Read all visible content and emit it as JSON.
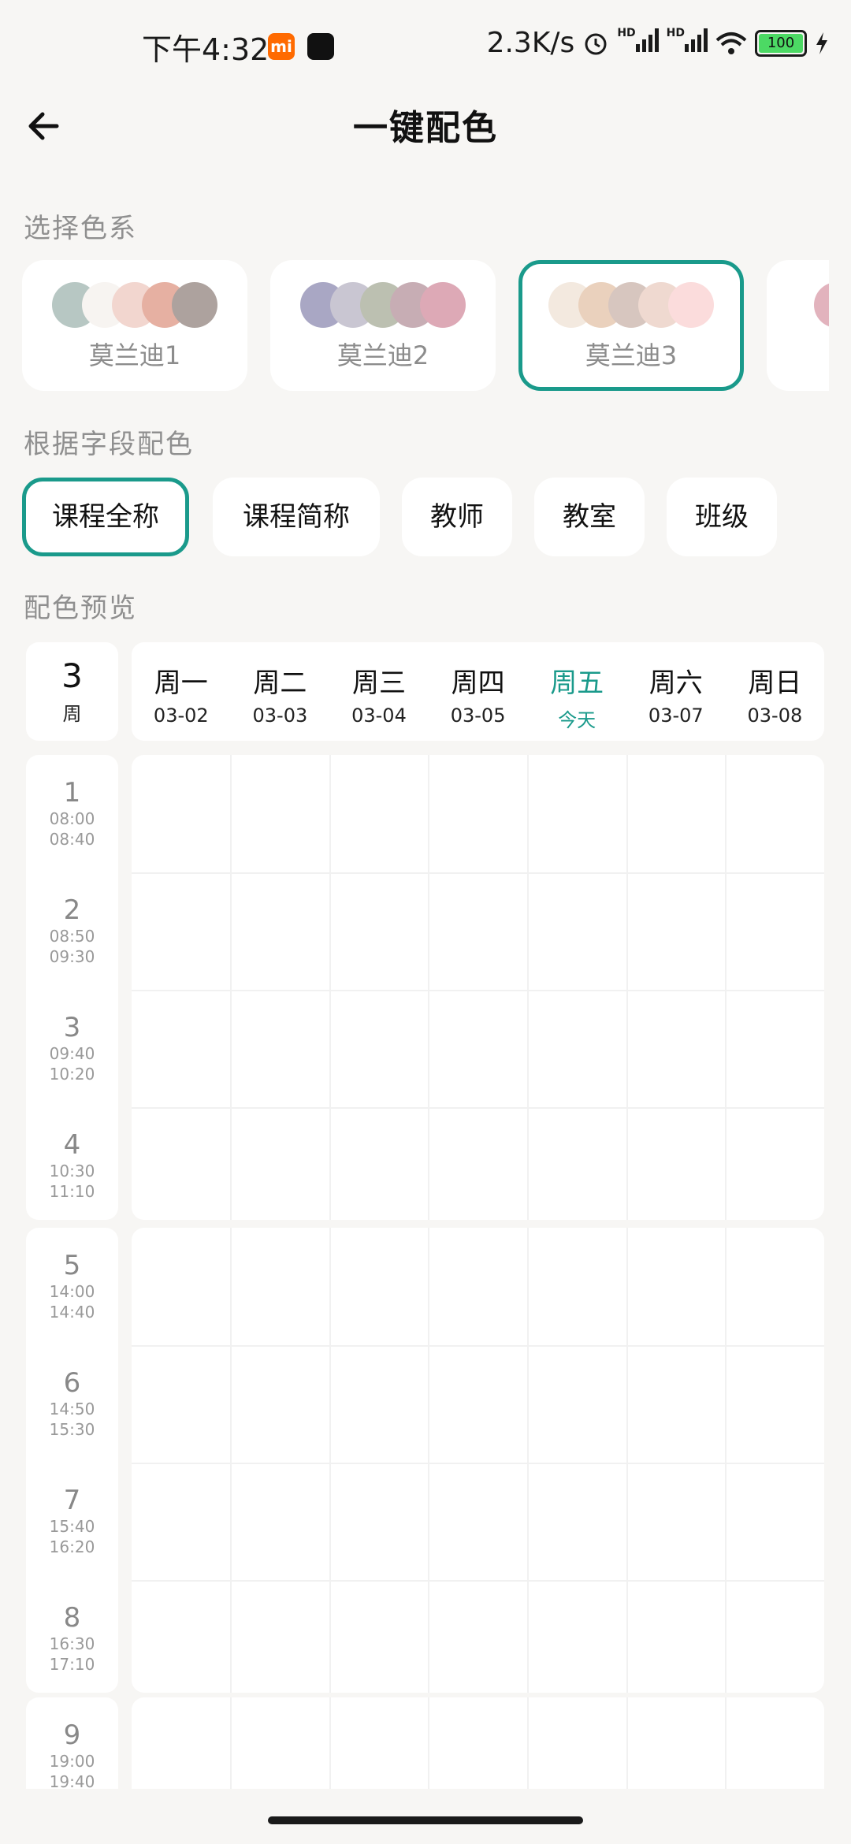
{
  "status_bar": {
    "time": "下午4:32",
    "network_speed": "2.3K/s",
    "battery": "100",
    "hd_label": "HD"
  },
  "header": {
    "title": "一键配色"
  },
  "sections": {
    "color_scheme": "选择色系",
    "by_field": "根据字段配色",
    "preview": "配色预览"
  },
  "schemes": [
    {
      "label": "莫兰迪1",
      "colors": [
        "#b7c7c3",
        "#f7f4f1",
        "#f2d6cf",
        "#e6b0a2",
        "#ada29e"
      ]
    },
    {
      "label": "莫兰迪2",
      "colors": [
        "#a9a7c4",
        "#c9c6d2",
        "#bcc0b1",
        "#c7adb4",
        "#dda9b6"
      ]
    },
    {
      "label": "莫兰迪3",
      "colors": [
        "#f3e9df",
        "#ead1bd",
        "#d7c6bf",
        "#efd9d0",
        "#fbdcdc"
      ],
      "selected": true
    }
  ],
  "fields": [
    {
      "label": "课程全称",
      "selected": true
    },
    {
      "label": "课程简称"
    },
    {
      "label": "教师"
    },
    {
      "label": "教室"
    },
    {
      "label": "班级"
    }
  ],
  "week": {
    "number": "3",
    "unit": "周"
  },
  "days": [
    {
      "name": "周一",
      "date": "03-02"
    },
    {
      "name": "周二",
      "date": "03-03"
    },
    {
      "name": "周三",
      "date": "03-04"
    },
    {
      "name": "周四",
      "date": "03-05"
    },
    {
      "name": "周五",
      "date": "今天",
      "today": true
    },
    {
      "name": "周六",
      "date": "03-07"
    },
    {
      "name": "周日",
      "date": "03-08"
    }
  ],
  "periods": [
    {
      "num": "1",
      "start": "08:00",
      "end": "08:40"
    },
    {
      "num": "2",
      "start": "08:50",
      "end": "09:30"
    },
    {
      "num": "3",
      "start": "09:40",
      "end": "10:20"
    },
    {
      "num": "4",
      "start": "10:30",
      "end": "11:10"
    },
    {
      "num": "5",
      "start": "14:00",
      "end": "14:40"
    },
    {
      "num": "6",
      "start": "14:50",
      "end": "15:30"
    },
    {
      "num": "7",
      "start": "15:40",
      "end": "16:20"
    },
    {
      "num": "8",
      "start": "16:30",
      "end": "17:10"
    },
    {
      "num": "9",
      "start": "19:00",
      "end": "19:40"
    }
  ],
  "colors": {
    "accent": "#1a9a8b",
    "background": "#f7f6f4",
    "card": "#ffffff"
  }
}
